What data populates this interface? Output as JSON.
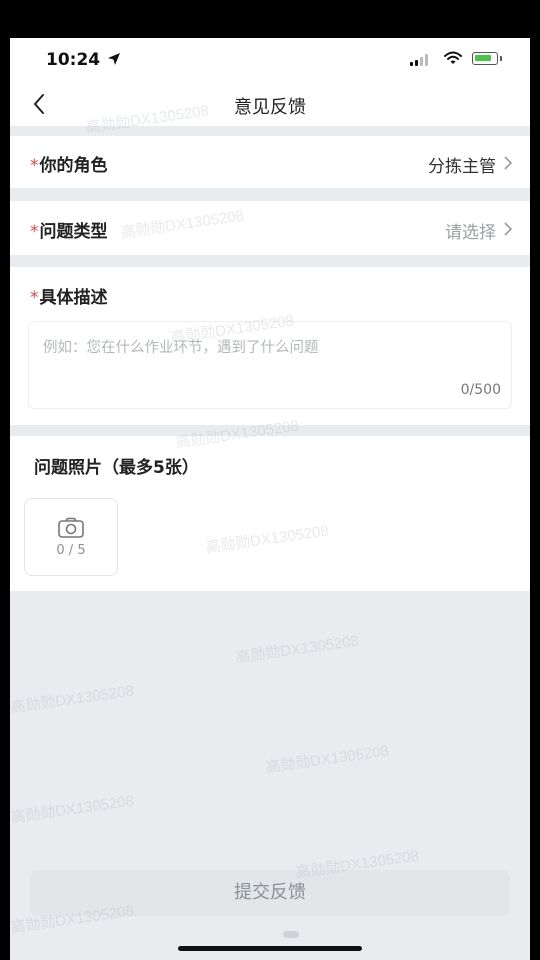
{
  "status_bar": {
    "time": "10:24"
  },
  "nav": {
    "title": "意见反馈"
  },
  "form": {
    "required_mark": "*",
    "role": {
      "label": "你的角色",
      "value": "分拣主管"
    },
    "issue_type": {
      "label": "问题类型",
      "value": "请选择"
    },
    "description": {
      "label": "具体描述",
      "placeholder": "例如：您在什么作业环节，遇到了什么问题",
      "counter": "0/500"
    },
    "photos": {
      "label": "问题照片（最多5张）",
      "count": "0 / 5"
    }
  },
  "submit": {
    "label": "提交反馈"
  },
  "watermark": {
    "text": "高勋勋DX1305208"
  },
  "colors": {
    "required": "#e64646",
    "divider_bg": "#e9ecef",
    "muted": "#9aa0a6"
  },
  "icons": [
    "location-arrow-icon",
    "signal-icon",
    "wifi-icon",
    "battery-icon",
    "back-icon",
    "chevron-right-icon",
    "camera-icon"
  ]
}
